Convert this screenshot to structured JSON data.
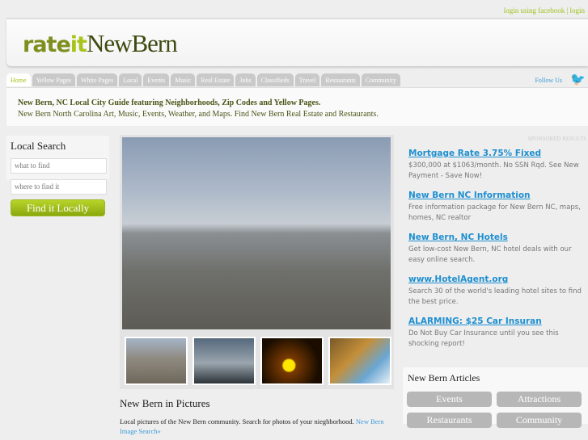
{
  "login": "login using facebook | login",
  "logo": {
    "rate": "rate",
    "it": "it",
    "name": "NewBern"
  },
  "tabs": [
    "Home",
    "Yellow Pages",
    "White Pages",
    "Local",
    "Events",
    "Music",
    "Real Estate",
    "Jobs",
    "Classifieds",
    "Travel",
    "Restaurants",
    "Community"
  ],
  "follow": "Follow Us",
  "tagline": {
    "title": "New Bern, NC Local City Guide featuring Neighborhoods, Zip Codes and Yellow Pages.",
    "subtitle": "New Bern North Carolina Art, Music, Events, Weather, and Maps. Find New Bern Real Estate and Restaurants."
  },
  "search": {
    "title": "Local Search",
    "what_placeholder": "what to find",
    "where_placeholder": "where to find it",
    "button": "Find it Locally"
  },
  "pictures": {
    "title": "New Bern in Pictures",
    "text": "Local pictures of the New Bern community. Search for photos of your nieghborhood. ",
    "link": "New Bern Image Search»"
  },
  "sponsored": "SPONSORED RESULTS",
  "ads": [
    {
      "title": "Mortgage Rate 3.75% Fixed",
      "text": "$300,000 at $1063/month. No SSN Rqd. See New Payment - Save Now!"
    },
    {
      "title": "New Bern NC Information",
      "text": "Free information package for New Bern NC, maps, homes, NC realtor"
    },
    {
      "title": "New Bern, NC Hotels",
      "text": "Get low-cost New Bern, NC hotel deals with our easy online search."
    },
    {
      "title": "www.HotelAgent.org",
      "text": "Search 30 of the world's leading hotel sites to find the best price."
    },
    {
      "title": "ALARMING: $25 Car Insuran",
      "text": "Do Not Buy Car Insurance until you see this shocking report!"
    }
  ],
  "articles": {
    "title": "New Bern Articles",
    "buttons": [
      "Events",
      "Attractions",
      "Restaurants",
      "Community"
    ]
  }
}
